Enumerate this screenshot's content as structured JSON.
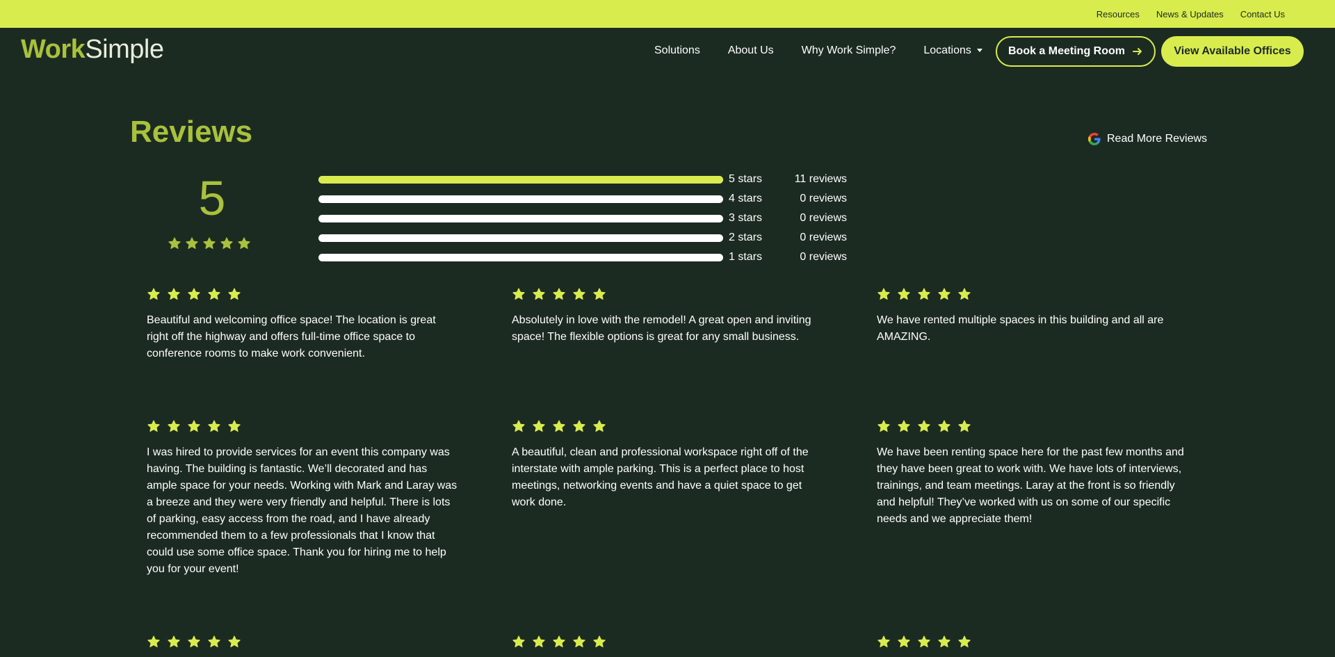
{
  "topbar": {
    "links": [
      "Resources",
      "News & Updates",
      "Contact Us"
    ]
  },
  "nav": {
    "logo_bold": "Work",
    "logo_light": "Simple",
    "links": [
      "Solutions",
      "About Us",
      "Why Work Simple?",
      "Locations"
    ],
    "book_button": "Book a Meeting Room",
    "offices_button": "View Available Offices"
  },
  "reviews": {
    "title": "Reviews",
    "read_more": "Read More Reviews",
    "average": "5",
    "average_stars": 5,
    "breakdown": [
      {
        "label": "5 stars",
        "count": "11 reviews",
        "fraction": 1.0
      },
      {
        "label": "4 stars",
        "count": "0 reviews",
        "fraction": 0
      },
      {
        "label": "3 stars",
        "count": "0 reviews",
        "fraction": 0
      },
      {
        "label": "2 stars",
        "count": "0 reviews",
        "fraction": 0
      },
      {
        "label": "1 stars",
        "count": "0 reviews",
        "fraction": 0
      }
    ],
    "items": [
      {
        "stars": 5,
        "text": "Beautiful and welcoming office space! The location is great right off the highway and offers full-time office space to conference rooms to make work convenient."
      },
      {
        "stars": 5,
        "text": "Absolutely in love with the remodel! A great open and inviting space! The flexible options is great for any small business."
      },
      {
        "stars": 5,
        "text": "We have rented multiple spaces in this building and all are AMAZING."
      },
      {
        "stars": 5,
        "text": "I was hired to provide services for an event this company was having. The building is fantastic. We’ll decorated and has ample space for your needs. Working with Mark and Laray was a breeze and they were very friendly and helpful. There is lots of parking, easy access from the road, and I have already recommended them to a few professionals that I know that could use some office space. Thank you for hiring me to help you for your event!"
      },
      {
        "stars": 5,
        "text": "A beautiful, clean and professional workspace right off of the interstate with ample parking. This is a perfect place to host meetings, networking events and have a quiet space to get work done."
      },
      {
        "stars": 5,
        "text": "We have been renting space here for the past few months and they have been great to work with. We have lots of interviews, trainings, and team meetings. Laray at the front is so friendly and helpful! They’ve worked with us on some of our specific needs and we appreciate them!"
      },
      {
        "stars": 5,
        "text": ""
      },
      {
        "stars": 5,
        "text": ""
      },
      {
        "stars": 5,
        "text": ""
      }
    ]
  },
  "colors": {
    "background": "#1c2b22",
    "accent": "#d9ec4e",
    "heading": "#a9c13c"
  }
}
